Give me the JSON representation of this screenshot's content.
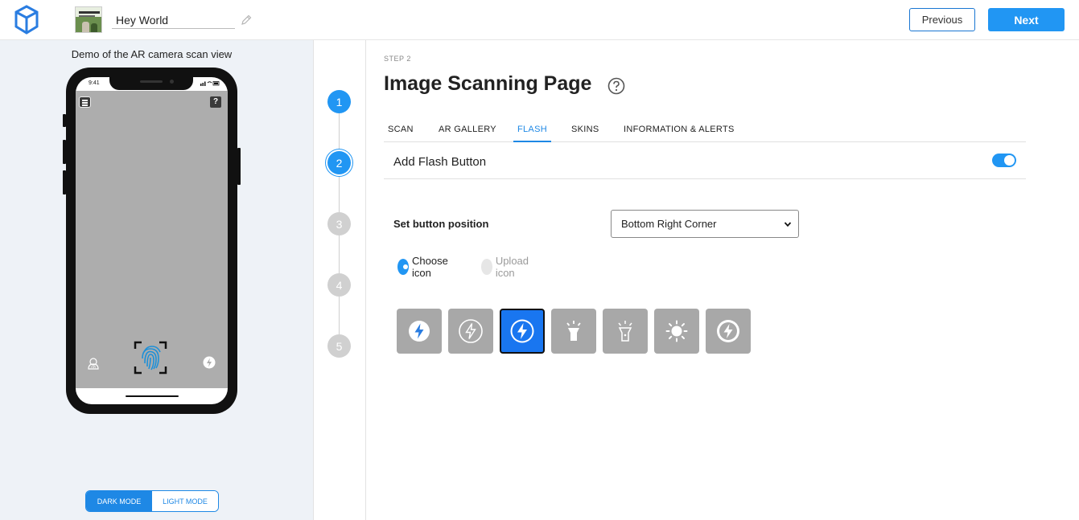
{
  "header": {
    "project_name": "Hey World",
    "previous_label": "Previous",
    "next_label": "Next"
  },
  "preview": {
    "caption": "Demo of the AR camera scan view",
    "status_time": "9:41",
    "help_glyph": "?",
    "modes": {
      "dark": "DARK MODE",
      "light": "LIGHT MODE",
      "selected": "dark"
    }
  },
  "stepper": {
    "steps": [
      "1",
      "2",
      "3",
      "4",
      "5"
    ],
    "current": 2
  },
  "main": {
    "step_label": "STEP 2",
    "title": "Image Scanning Page",
    "tabs": [
      "SCAN",
      "AR GALLERY",
      "FLASH",
      "SKINS",
      "INFORMATION & ALERTS"
    ],
    "active_tab": "FLASH",
    "flash_toggle_label": "Add Flash Button",
    "flash_enabled": true,
    "position_label": "Set button position",
    "position_value": "Bottom Right Corner",
    "icon_source": {
      "choose": "Choose icon",
      "upload": "Upload icon",
      "selected": "choose"
    },
    "icons": [
      "flash-circle-icon",
      "flash-outline-circle-icon",
      "flash-filled-icon",
      "flashlight-icon",
      "flashlight-outline-icon",
      "sun-icon",
      "flash-ring-icon"
    ],
    "selected_icon": 2
  },
  "colors": {
    "accent": "#2196f3",
    "tile": "#a8a8a8",
    "left_panel_bg": "#eef2f7"
  }
}
